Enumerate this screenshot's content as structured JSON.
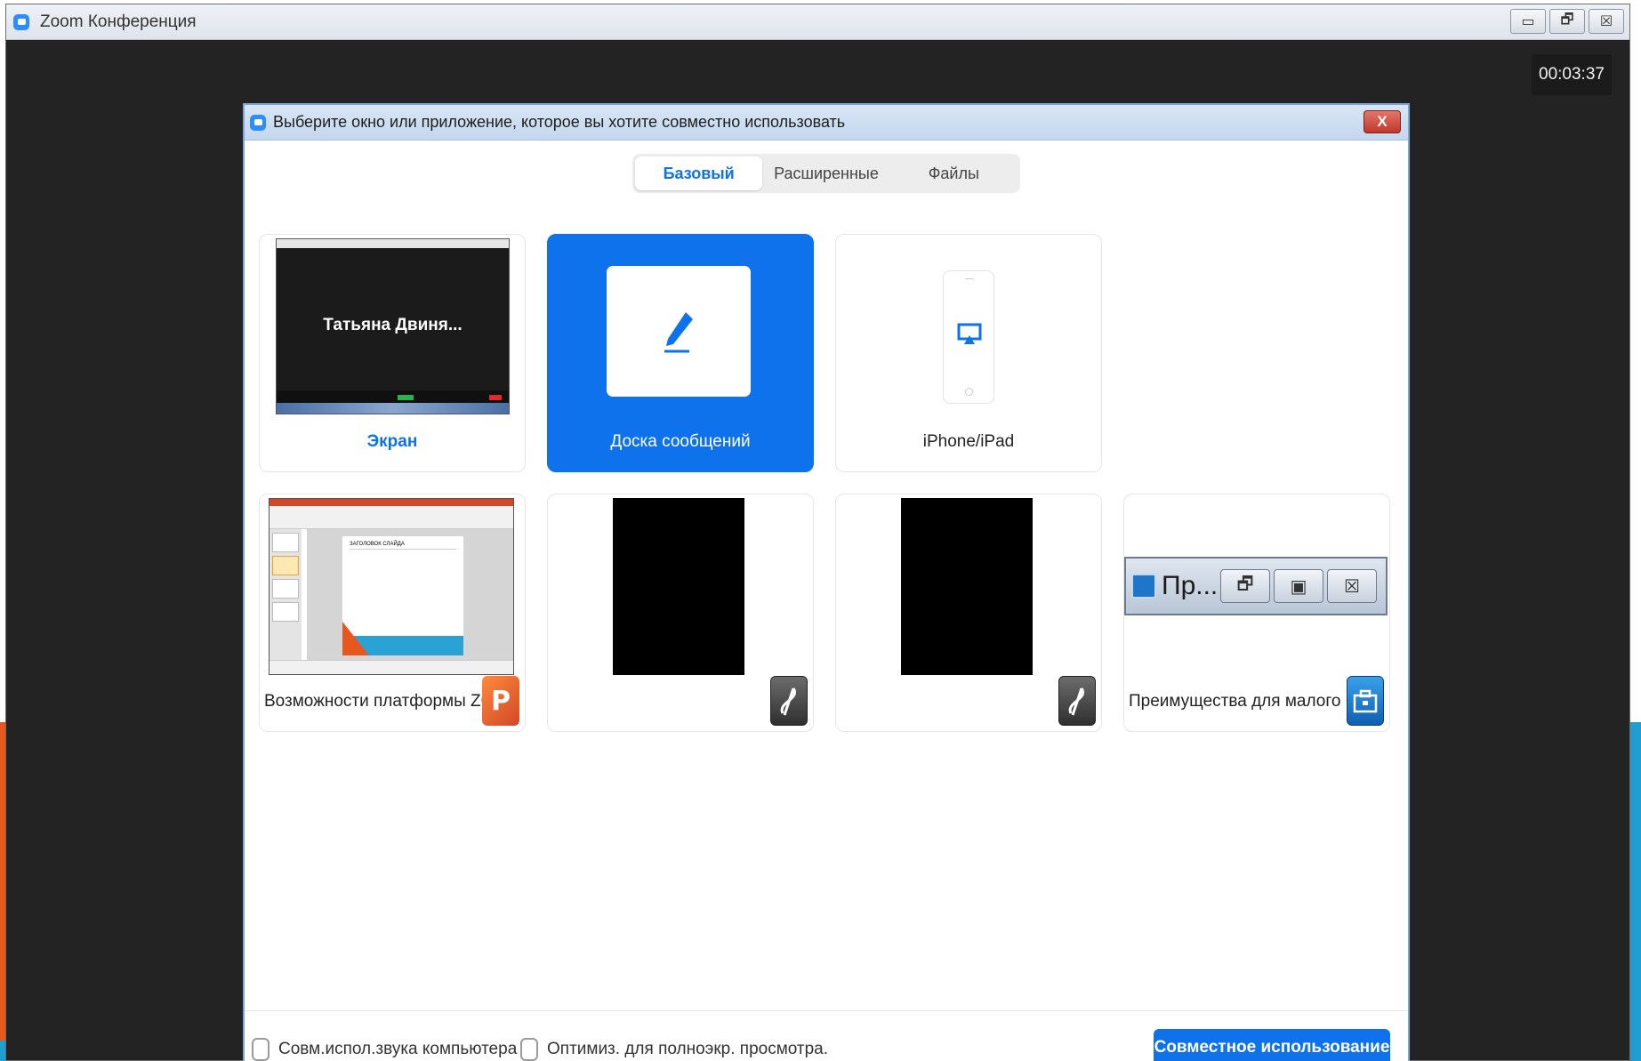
{
  "window": {
    "title": "Zoom Конференция",
    "controls": {
      "minimize": "▭",
      "restore": "🗗",
      "close": "☒"
    }
  },
  "timer": "00:03:37",
  "dialog": {
    "title": "Выберите окно или приложение, которое вы хотите совместно использовать",
    "close_label": "X",
    "tabs": [
      {
        "label": "Базовый",
        "active": true
      },
      {
        "label": "Расширенные",
        "active": false
      },
      {
        "label": "Файлы",
        "active": false
      }
    ],
    "tiles": {
      "screen": {
        "label": "Экран",
        "thumb_text": "Татьяна Двиня..."
      },
      "whiteboard": {
        "label": "Доска сообщений"
      },
      "iphone": {
        "label": "iPhone/iPad"
      },
      "ppt": {
        "label": "Возможности платформы ZOO...",
        "badge": "P",
        "slide_title": "ЗАГОЛОВОК СЛАЙДА"
      },
      "black1": {
        "label": ""
      },
      "black2": {
        "label": ""
      },
      "biz": {
        "label": "Преимущества для малого биз...",
        "window_title": "Пр..."
      }
    },
    "footer": {
      "share_audio": "Совм.испол.звука компьютера",
      "optimize": "Оптимиз. для полноэкр. просмотра.",
      "share_button": "Совместное использование"
    }
  },
  "colors": {
    "accent_blue": "#0e72ed",
    "slide_orange": "#e8571e",
    "slide_cyan": "#1f9fd1"
  }
}
